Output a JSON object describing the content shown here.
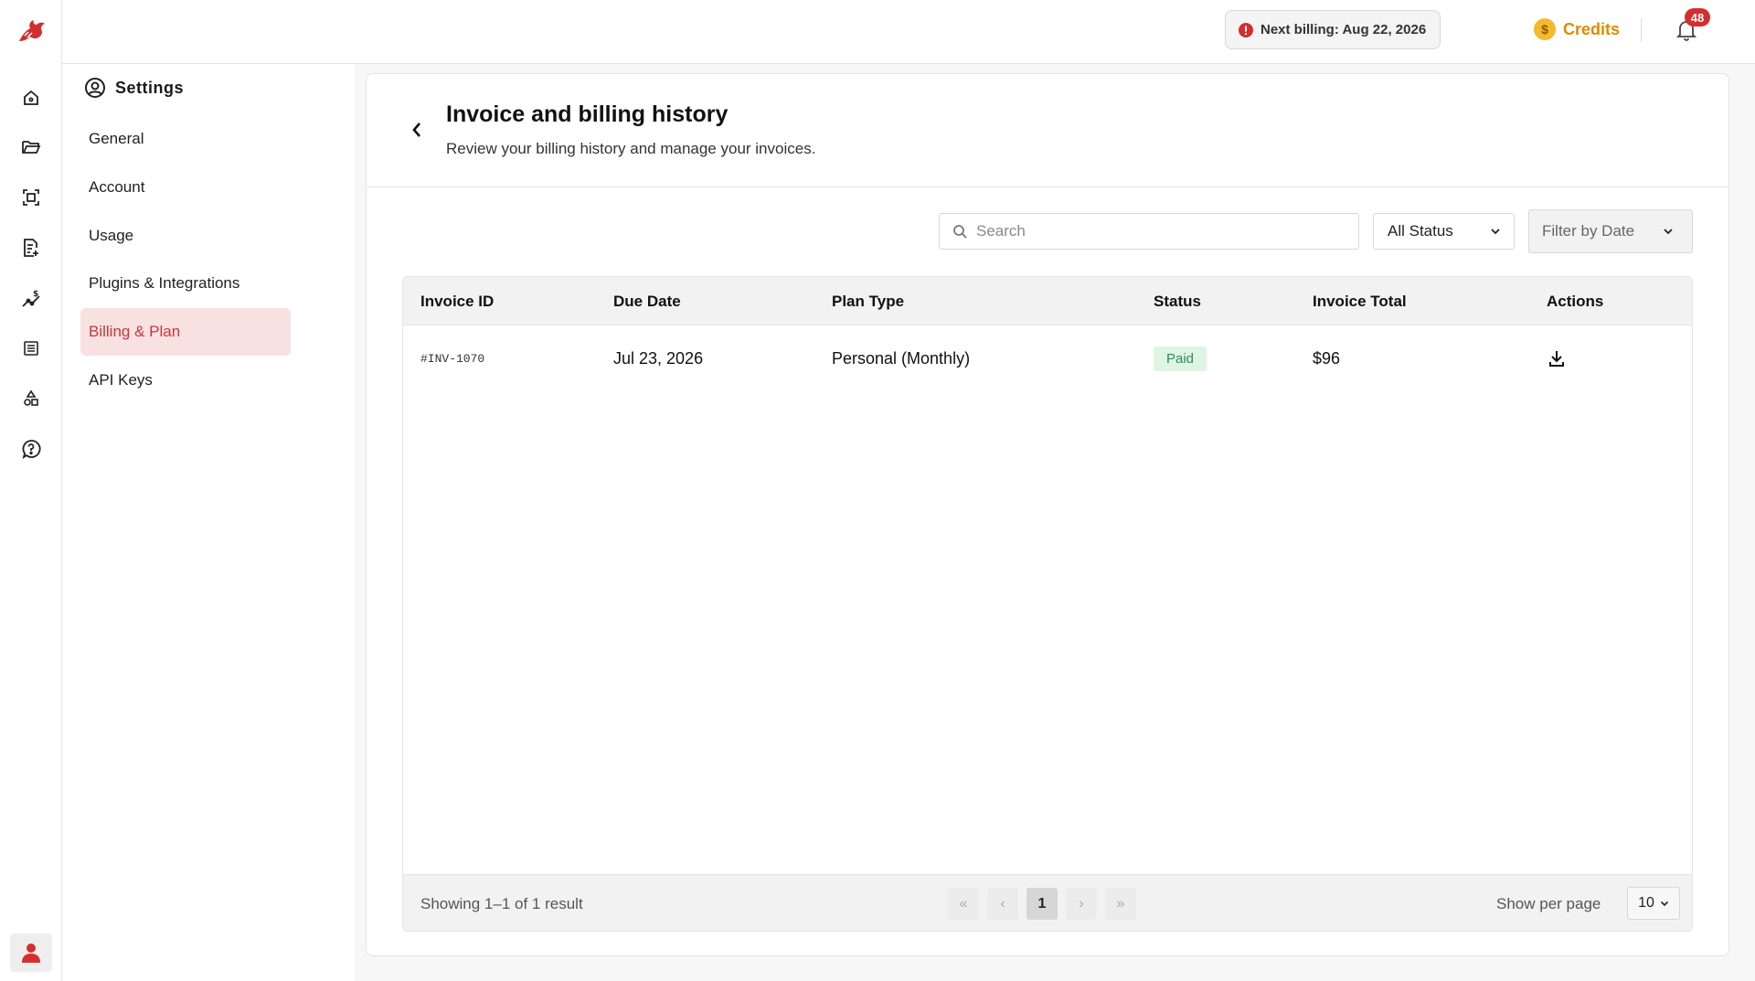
{
  "topbar": {
    "next_billing": "Next billing: Aug 22, 2026",
    "credits_label": "Credits",
    "credits_icon_glyph": "$",
    "notifications_count": "48"
  },
  "rail": {
    "icons": [
      "home-icon",
      "folder-icon",
      "scan-icon",
      "document-add-icon",
      "analytics-icon",
      "table-icon",
      "shapes-icon",
      "help-icon"
    ],
    "accent_color": "#d32f2f"
  },
  "settings": {
    "title": "Settings",
    "items": [
      {
        "label": "General",
        "active": false
      },
      {
        "label": "Account",
        "active": false
      },
      {
        "label": "Usage",
        "active": false
      },
      {
        "label": "Plugins & Integrations",
        "active": false
      },
      {
        "label": "Billing & Plan",
        "active": true
      },
      {
        "label": "API Keys",
        "active": false
      }
    ]
  },
  "page": {
    "title": "Invoice and billing history",
    "subtitle": "Review your billing history and manage your invoices."
  },
  "filters": {
    "search_placeholder": "Search",
    "status_selected": "All Status",
    "date_placeholder": "Filter by Date"
  },
  "table": {
    "columns": [
      "Invoice ID",
      "Due Date",
      "Plan Type",
      "Status",
      "Invoice Total",
      "Actions"
    ],
    "rows": [
      {
        "invoice_id": "#INV-1070",
        "due_date": "Jul 23, 2026",
        "plan_type": "Personal (Monthly)",
        "status": "Paid",
        "total": "$96",
        "action_icon": "download-icon"
      }
    ],
    "status_colors": {
      "paid_bg": "#dff5e3",
      "paid_text": "#2e8b57"
    }
  },
  "pagination": {
    "summary": "Showing 1–1 of 1 result",
    "first": "«",
    "prev": "‹",
    "current_page": "1",
    "next": "›",
    "last": "»",
    "per_page_label": "Show per page",
    "per_page_value": "10"
  }
}
